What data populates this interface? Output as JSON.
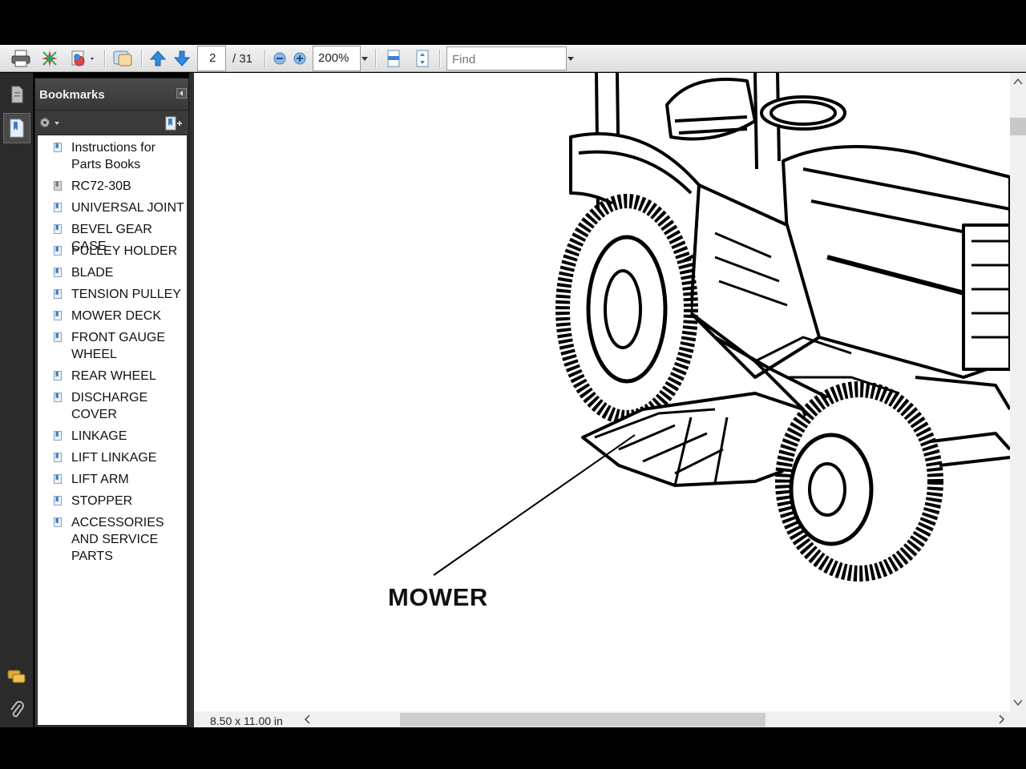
{
  "toolbar": {
    "page_current": "2",
    "page_total": "/ 31",
    "zoom": "200%",
    "find_placeholder": "Find"
  },
  "panel": {
    "title": "Bookmarks"
  },
  "bookmarks": [
    "Instructions for Parts Books",
    "RC72-30B",
    "UNIVERSAL JOINT",
    "BEVEL GEAR CASE",
    "PULLEY HOLDER",
    "BLADE",
    "TENSION PULLEY",
    "MOWER DECK",
    "FRONT GAUGE WHEEL",
    "REAR WHEEL",
    "DISCHARGE COVER",
    "LINKAGE",
    "LIFT LINKAGE",
    "LIFT ARM",
    "STOPPER",
    "ACCESSORIES AND SERVICE PARTS"
  ],
  "document": {
    "callout_label": "MOWER",
    "page_size": "8.50 x 11.00 in"
  },
  "colors": {
    "toolbar_bg": "#e6e6e6",
    "panel_bg": "#3a3a3a",
    "nav_strip_bg": "#2b2b2b",
    "bookmark_icon": "#3a7fc4"
  }
}
